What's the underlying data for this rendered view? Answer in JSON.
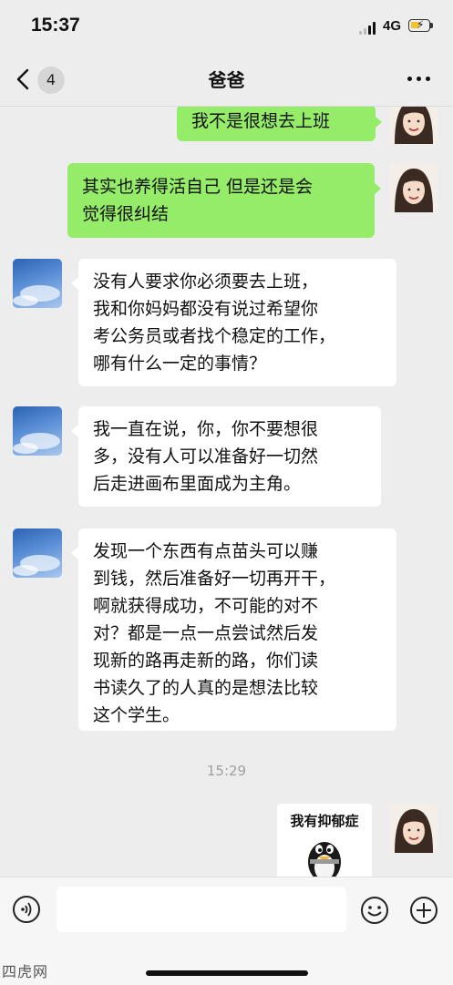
{
  "status_bar": {
    "time": "15:37",
    "network": "4G",
    "battery_level": 0.4,
    "battery_color": "#f1c232"
  },
  "nav": {
    "back_icon": "chevron-left-icon",
    "unread_count": "4",
    "title": "爸爸",
    "more_icon": "more-dots-icon"
  },
  "messages": [
    {
      "side": "right",
      "avatar": "girl-avatar",
      "text": "我不是很想去上班"
    },
    {
      "side": "right",
      "avatar": "girl-avatar",
      "text": "其实也养得活自己 但是还是会\n觉得很纠结"
    },
    {
      "side": "left",
      "avatar": "sky-avatar",
      "text": "没有人要求你必须要去上班，\n我和你妈妈都没有说过希望你\n考公务员或者找个稳定的工作，\n哪有什么一定的事情？"
    },
    {
      "side": "left",
      "avatar": "sky-avatar",
      "text": "我一直在说，你，你不要想很\n多，没有人可以准备好一切然\n后走进画布里面成为主角。"
    },
    {
      "side": "left",
      "avatar": "sky-avatar",
      "text": "发现一个东西有点苗头可以赚\n到钱，然后准备好一切再开干，\n啊就获得成功，不可能的对不\n对？都是一点一点尝试然后发\n现新的路再走新的路，你们读\n书读久了的人真的是想法比较\n这个学生。"
    }
  ],
  "timestamp": "15:29",
  "sticker": {
    "text": "我有抑郁症",
    "image": "qq-penguin-sticker"
  },
  "input_bar": {
    "voice_icon": "voice-icon",
    "placeholder": "",
    "emoji_icon": "emoji-icon",
    "plus_icon": "plus-icon"
  },
  "colors": {
    "background": "#ededed",
    "bubble_self": "#95ec69",
    "bubble_other": "#ffffff",
    "timestamp": "#a0a0a0"
  },
  "watermark": "四虎网"
}
